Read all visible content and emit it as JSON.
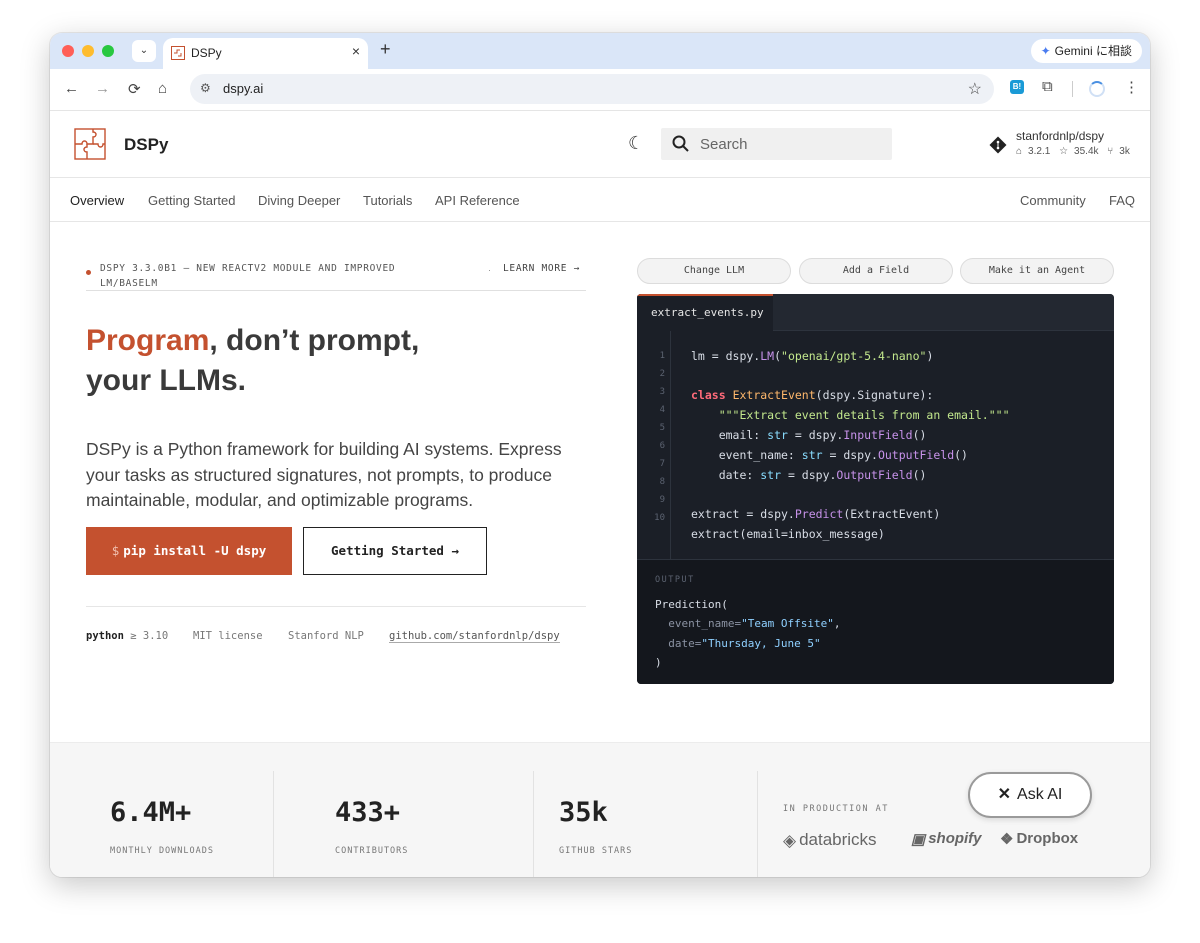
{
  "browser": {
    "tab_title": "DSPy",
    "tab_close": "×",
    "new_tab": "+",
    "tab_search": "⌄",
    "gemini_label": "Gemini に相談",
    "url": "dspy.ai",
    "back": "←",
    "forward": "→",
    "reload": "⟳",
    "home": "⌂",
    "bookmark": "☆",
    "extensions": "⧉",
    "menu": "⋮",
    "ext_badge": "B!"
  },
  "header": {
    "brand": "DSPy",
    "theme_icon": "☾",
    "search_placeholder": "Search",
    "repo_name": "stanfordnlp/dspy",
    "repo_version": "3.2.1",
    "repo_stars": "35.4k",
    "repo_forks": "3k"
  },
  "nav": {
    "items": [
      "Overview",
      "Getting Started",
      "Diving Deeper",
      "Tutorials",
      "API Reference"
    ],
    "right_items": [
      "Community",
      "FAQ"
    ]
  },
  "hero": {
    "announcement": "DSPY 3.3.0B1 — NEW REACTV2 MODULE AND IMPROVED LM/BASELM",
    "announcement_sep": "·",
    "learn_more": "LEARN MORE →",
    "headline_accent": "Program",
    "headline_rest": ", don’t prompt,",
    "headline_line2": "your LLMs.",
    "description": "DSPy is a Python framework for building AI systems. Express your tasks as structured signatures, not prompts, to produce maintainable, modular, and optimizable programs.",
    "pip_dollar": "$",
    "pip_command": "pip install -U dspy",
    "getting_started": "Getting Started →",
    "meta_python_label": "python",
    "meta_python_version": "≥ 3.10",
    "meta_license": "MIT license",
    "meta_org": "Stanford NLP",
    "meta_repo": "github.com/stanfordnlp/dspy"
  },
  "code_demo": {
    "buttons": [
      "Change LLM",
      "Add a Field",
      "Make it an Agent"
    ],
    "filename": "extract_events.py",
    "line_numbers": [
      "1",
      "2",
      "3",
      "4",
      "5",
      "6",
      "7",
      "8",
      "9",
      "10"
    ],
    "output_label": "OUTPUT",
    "output_open": "Prediction(",
    "output_k1": "event_name=",
    "output_v1": "\"Team Offsite\"",
    "output_comma": ",",
    "output_k2": "date=",
    "output_v2": "\"Thursday, June 5\"",
    "output_close": ")"
  },
  "stats": {
    "items": [
      {
        "value": "6.4M+",
        "label": "MONTHLY DOWNLOADS"
      },
      {
        "value": "433+",
        "label": "CONTRIBUTORS"
      },
      {
        "value": "35k",
        "label": "GITHUB STARS"
      }
    ],
    "production_label": "IN PRODUCTION AT",
    "companies": [
      "databricks",
      "shopify",
      "Dropbox"
    ]
  },
  "ask_ai": "Ask AI",
  "colors": {
    "accent": "#c4512f",
    "code_bg": "#1b1f27",
    "tab_strip": "#dae6f8"
  }
}
